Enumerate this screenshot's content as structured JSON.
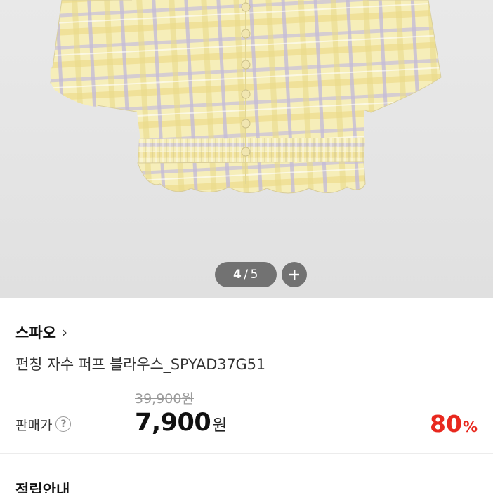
{
  "gallery": {
    "current": "4",
    "separator": "/",
    "total": "5",
    "more_icon": "plus-icon"
  },
  "product": {
    "brand": "스파오",
    "brand_chevron": "›",
    "title": "펀칭 자수 퍼프 블라우스_SPYAD37G51",
    "original_price": "39,900원",
    "price_label": "판매가",
    "help_icon_glyph": "?",
    "sale_price": "7,900",
    "sale_unit": "원",
    "discount_value": "80",
    "discount_unit": "%"
  },
  "section": {
    "title": "적립안내"
  },
  "colors": {
    "discount": "#e8281e",
    "blouse_yellow": "#f3e7a8",
    "check_lavender": "#c7bfd8"
  }
}
